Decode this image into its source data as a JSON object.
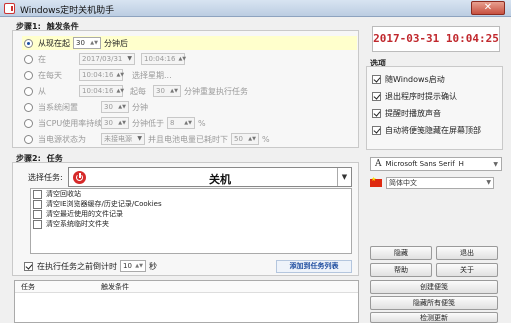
{
  "window": {
    "title": "Windows定时关机助手",
    "close_glyph": "✕"
  },
  "step1": {
    "label": "步骤1:",
    "trigger_label": "触发条件",
    "options": [
      {
        "label": "从现在起",
        "value": "30",
        "suffix": "分钟后",
        "selected": true
      },
      {
        "label": "在",
        "date": "2017/03/31",
        "time": "10:04:16"
      },
      {
        "label": "在每天",
        "time": "10:04:16",
        "extra": "选择星期..."
      },
      {
        "label": "从",
        "time": "10:04:16",
        "mid": "起每",
        "value": "30",
        "suffix": "分钟重复执行任务"
      },
      {
        "label": "当系统闲置",
        "value": "30",
        "suffix": "分钟"
      },
      {
        "label": "当CPU使用率持续",
        "value": "30",
        "mid": "分钟低于",
        "value2": "8",
        "suffix": "%"
      },
      {
        "label": "当电源状态为",
        "combo": "未接电源",
        "mid": "并且电池电量已耗时下",
        "value": "50",
        "suffix": "%"
      }
    ]
  },
  "clock": "2017-03-31  10:04:25",
  "options_panel": {
    "label": "选项",
    "items": [
      {
        "label": "随Windows启动",
        "checked": true
      },
      {
        "label": "退出程序时提示确认",
        "checked": true
      },
      {
        "label": "提醒时播放声音",
        "checked": true
      },
      {
        "label": "自动将便笺隐藏在屏幕顶部",
        "checked": true
      }
    ],
    "font": "Microsoft Sans Serif",
    "font_size": "H",
    "language": "简体中文"
  },
  "step2": {
    "label": "步骤2:",
    "task_label": "任务",
    "select_label": "选择任务:",
    "selected_task": "关机",
    "tasks": [
      "清空回收站",
      "清空IE浏览器缓存/历史记录/Cookies",
      "清空最近使用的文件记录",
      "清空系统临时文件夹"
    ],
    "countdown_label": "在执行任务之前倒计时",
    "countdown_value": "10",
    "countdown_unit": "秒",
    "add_button": "添加到任务列表"
  },
  "grid": {
    "columns": [
      "任务",
      "触发条件"
    ]
  },
  "buttons": {
    "hide": "隐藏",
    "exit": "退出",
    "help": "帮助",
    "about": "关于",
    "create_note": "创建便笺",
    "hide_all_notes": "隐藏所有便笺",
    "check_update": "检测更新"
  }
}
